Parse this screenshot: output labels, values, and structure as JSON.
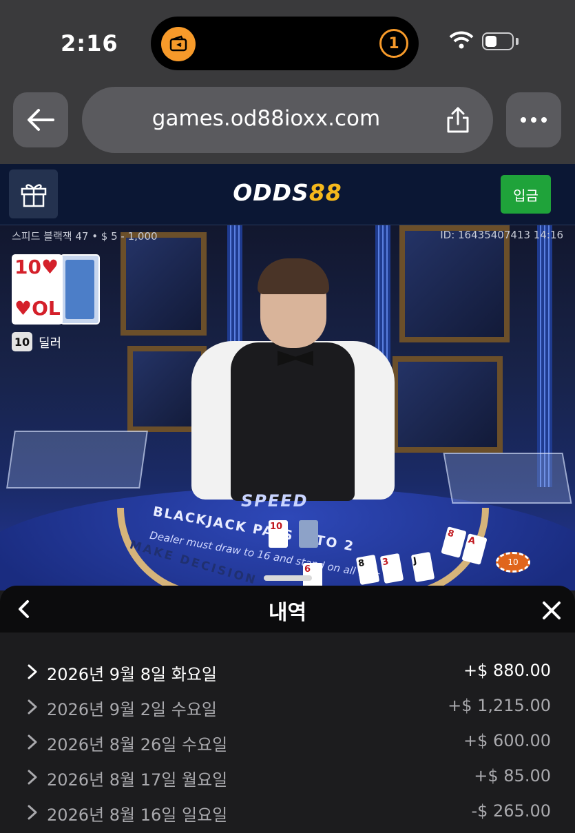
{
  "status_bar": {
    "time": "2:16",
    "island_badge": "1"
  },
  "browser": {
    "url": "games.od88ioxx.com"
  },
  "site": {
    "logo_part1": "ODDS",
    "logo_part2": "88",
    "deposit_label": "입금"
  },
  "game": {
    "table_info": "스피드 블랙잭 47 • $ 5 - 1,000",
    "round_id": "ID: 16435407413 14:16",
    "dealer_card_rank": "10",
    "dealer_card_rank_bottom": "OL",
    "dealer_score": "10",
    "dealer_label": "딜러",
    "felt_brand": "SPEED",
    "felt_payout": "BLACKJACK PAYS 3 TO 2",
    "felt_rule": "Dealer must draw to 16 and stand on all 17's",
    "felt_decision": "MAKE DECISION",
    "chip_value": "10"
  },
  "history_panel": {
    "title": "내역",
    "rows": [
      {
        "date": "2026년 9월 8일 화요일",
        "amount": "+$ 880.00",
        "highlight": true
      },
      {
        "date": "2026년 9월 2일 수요일",
        "amount": "+$ 1,215.00",
        "highlight": false
      },
      {
        "date": "2026년 8월 26일 수요일",
        "amount": "+$ 600.00",
        "highlight": false
      },
      {
        "date": "2026년 8월 17일 월요일",
        "amount": "+$ 85.00",
        "highlight": false
      },
      {
        "date": "2026년 8월 16일 일요일",
        "amount": "-$ 265.00",
        "highlight": false
      }
    ]
  },
  "colors": {
    "accent_orange": "#f79a2a",
    "deposit_green": "#1fa33a",
    "logo_gold": "#f5b81c",
    "header_navy": "#0b1734"
  }
}
